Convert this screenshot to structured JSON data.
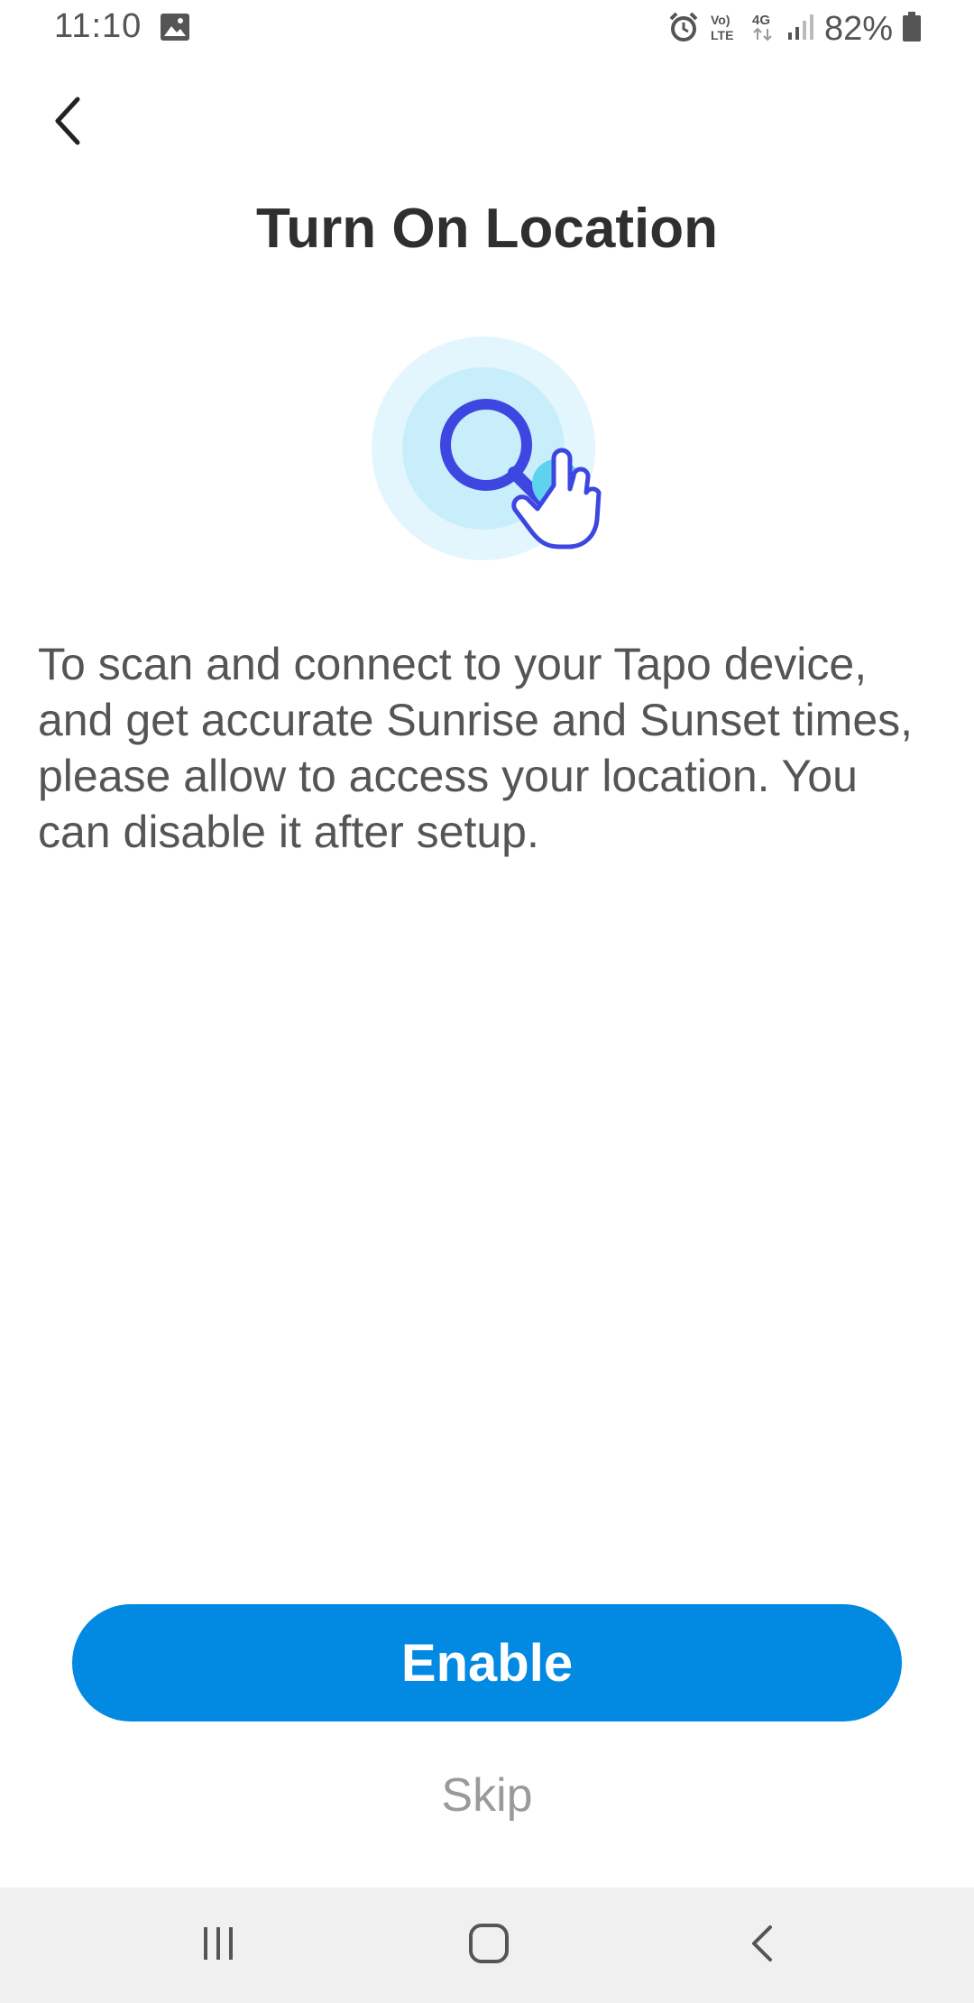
{
  "status_bar": {
    "time": "11:10",
    "gallery_icon": "image-icon",
    "right_icons": [
      "alarm-icon",
      "volte-icon",
      "4g-icon",
      "signal-icon",
      "battery-icon"
    ],
    "battery_percent": "82%"
  },
  "header": {
    "back_icon": "chevron-left-icon",
    "title": "Turn On Location"
  },
  "hero": {
    "icon": "search-location-icon",
    "colors": {
      "outer_ring": "#e4f6fd",
      "inner_ring": "#c8eefb",
      "lens": "#3d46e0",
      "dot": "#5ed2ef"
    }
  },
  "body": {
    "description": "To scan and connect to your Tapo device, and get accurate Sunrise and Sunset times, please allow to access your location. You can disable it after setup."
  },
  "actions": {
    "enable_label": "Enable",
    "skip_label": "Skip"
  },
  "nav_bar": {
    "recents_icon": "recents-icon",
    "home_icon": "home-icon",
    "back_icon": "back-icon"
  },
  "colors": {
    "primary": "#0289e2",
    "title_text": "#2f2f2f",
    "body_text": "#555555",
    "skip_text": "#9a9a9a",
    "nav_bg": "#f0f0f0"
  }
}
